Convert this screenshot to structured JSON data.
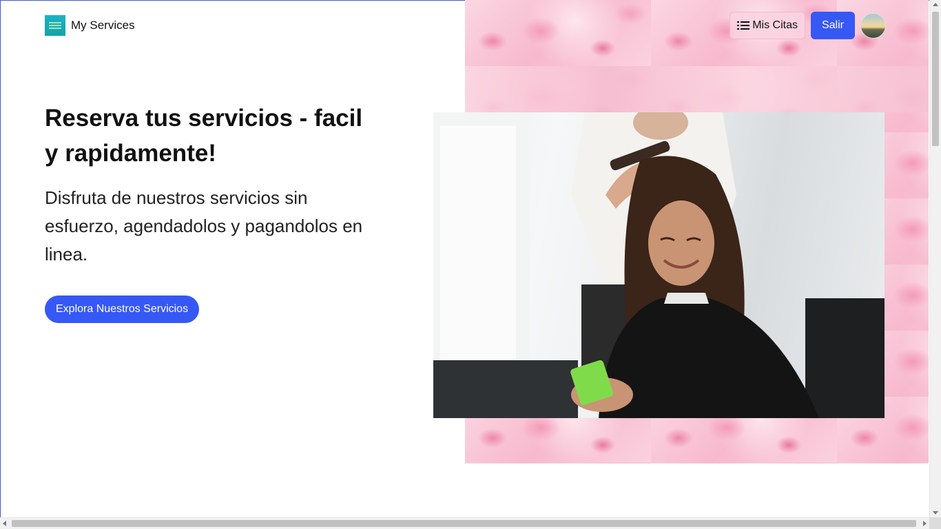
{
  "header": {
    "brand_name": "My Services",
    "logo_icon": "brand-logo-icon",
    "nav": {
      "citas_label": "Mis Citas",
      "citas_icon": "list-icon",
      "salir_label": "Salir",
      "avatar_icon": "user-avatar"
    }
  },
  "hero": {
    "headline": "Reserva tus servicios - facil y rapidamente!",
    "subtext": "Disfruta de nuestros servicios sin esfuerzo, agendadolos y pagandolos en linea.",
    "cta_label": "Explora Nuestros Servicios",
    "image_icon": "salon-photo"
  },
  "colors": {
    "primary": "#3658f5",
    "pink_background": "#f9c8d8",
    "text": "#111111"
  }
}
